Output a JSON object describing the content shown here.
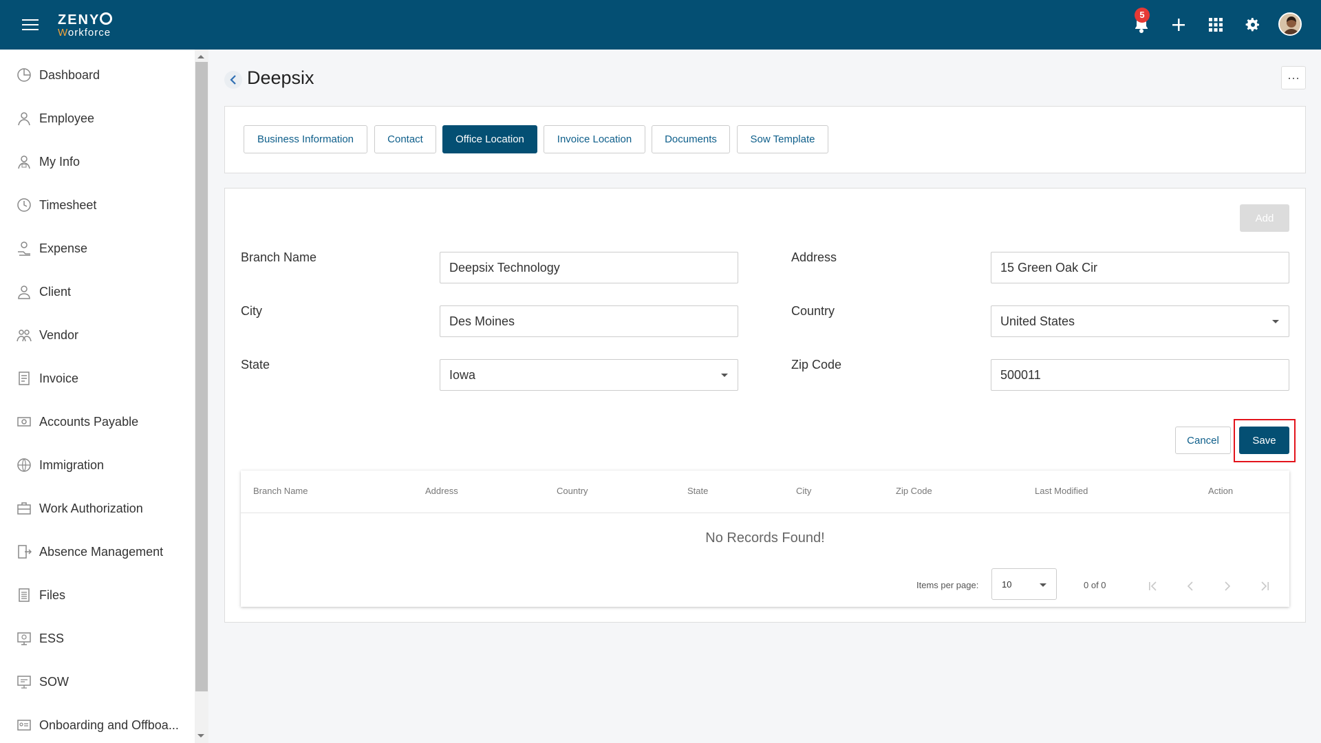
{
  "app": {
    "logo_line1_a": "ZENY",
    "logo_line2_a": "W",
    "logo_line2_b": "orkforce",
    "notification_count": "5"
  },
  "sidebar": {
    "items": [
      {
        "label": "Dashboard",
        "icon": "dashboard-icon"
      },
      {
        "label": "Employee",
        "icon": "employee-icon"
      },
      {
        "label": "My Info",
        "icon": "my-info-icon"
      },
      {
        "label": "Timesheet",
        "icon": "timesheet-icon"
      },
      {
        "label": "Expense",
        "icon": "expense-icon"
      },
      {
        "label": "Client",
        "icon": "client-icon"
      },
      {
        "label": "Vendor",
        "icon": "vendor-icon"
      },
      {
        "label": "Invoice",
        "icon": "invoice-icon"
      },
      {
        "label": "Accounts Payable",
        "icon": "accounts-payable-icon"
      },
      {
        "label": "Immigration",
        "icon": "immigration-icon"
      },
      {
        "label": "Work Authorization",
        "icon": "work-authorization-icon"
      },
      {
        "label": "Absence Management",
        "icon": "absence-management-icon"
      },
      {
        "label": "Files",
        "icon": "files-icon"
      },
      {
        "label": "ESS",
        "icon": "ess-icon"
      },
      {
        "label": "SOW",
        "icon": "sow-icon"
      },
      {
        "label": "Onboarding and Offboa...",
        "icon": "onboarding-icon"
      }
    ]
  },
  "header": {
    "title": "Deepsix",
    "more_label": "···"
  },
  "tabs": [
    {
      "label": "Business Information"
    },
    {
      "label": "Contact"
    },
    {
      "label": "Office Location"
    },
    {
      "label": "Invoice Location"
    },
    {
      "label": "Documents"
    },
    {
      "label": "Sow Template"
    }
  ],
  "active_tab": "Office Location",
  "form": {
    "add_label": "Add",
    "branch_name": {
      "label": "Branch Name",
      "value": "Deepsix Technology"
    },
    "address": {
      "label": "Address",
      "value": "15 Green Oak Cir"
    },
    "city": {
      "label": "City",
      "value": "Des Moines"
    },
    "country": {
      "label": "Country",
      "value": "United States"
    },
    "state": {
      "label": "State",
      "value": "Iowa"
    },
    "zip": {
      "label": "Zip Code",
      "value": "500011"
    },
    "cancel_label": "Cancel",
    "save_label": "Save"
  },
  "table": {
    "columns": [
      "Branch Name",
      "Address",
      "Country",
      "State",
      "City",
      "Zip Code",
      "Last Modified",
      "Action"
    ],
    "empty_text": "No Records Found!",
    "items_per_page_label": "Items per page:",
    "items_per_page_value": "10",
    "range_text": "0 of 0"
  },
  "colors": {
    "primary": "#044f73",
    "accent_logo": "#f2a33a",
    "badge": "#e53935",
    "highlight": "#e3131b"
  }
}
